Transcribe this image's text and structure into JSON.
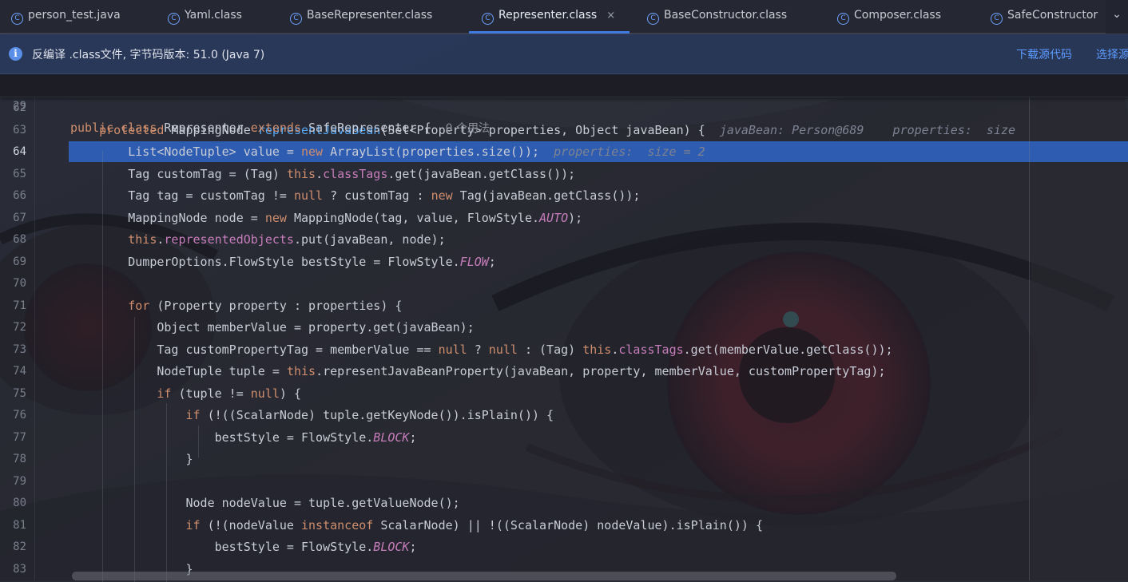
{
  "tabs": [
    {
      "label": "person_test.java",
      "active": false
    },
    {
      "label": "Yaml.class",
      "active": false
    },
    {
      "label": "BaseRepresenter.class",
      "active": false
    },
    {
      "label": "Representer.class",
      "active": true
    },
    {
      "label": "BaseConstructor.class",
      "active": false
    },
    {
      "label": "Composer.class",
      "active": false
    },
    {
      "label": "SafeConstructor",
      "active": false
    }
  ],
  "tab_icon_glyph": "C",
  "tab_close_glyph": "×",
  "tab_overflow_glyph": "⌄",
  "banner": {
    "info_glyph": "i",
    "text": "反编译 .class文件, 字节码版本: 51.0 (Java 7)",
    "download_link": "下载源代码",
    "choose_link": "选择源"
  },
  "sticky": {
    "line_number": "29",
    "usage": "0 个用法"
  },
  "current_line": "64",
  "colors": {
    "keyword": "#cf8e6d",
    "method": "#56a8f5",
    "field": "#c77dbb",
    "highlight": "#2e5cb0",
    "accent": "#3f7ae0",
    "link": "#5c9bff"
  }
}
